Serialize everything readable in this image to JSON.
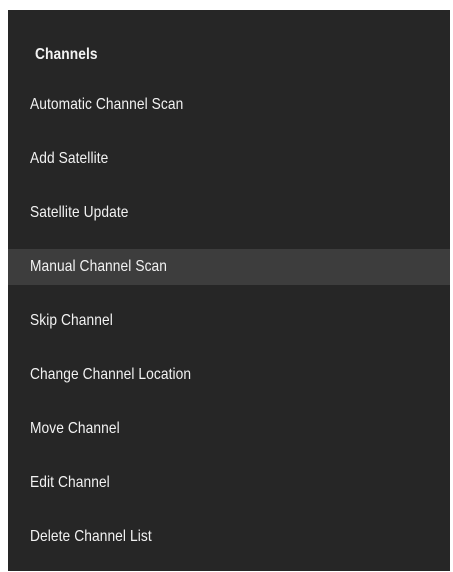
{
  "menu": {
    "title": "Channels",
    "items": [
      {
        "label": "Automatic Channel Scan",
        "selected": false
      },
      {
        "label": "Add Satellite",
        "selected": false
      },
      {
        "label": "Satellite Update",
        "selected": false
      },
      {
        "label": "Manual Channel Scan",
        "selected": true
      },
      {
        "label": "Skip Channel",
        "selected": false
      },
      {
        "label": "Change Channel Location",
        "selected": false
      },
      {
        "label": "Move Channel",
        "selected": false
      },
      {
        "label": "Edit Channel",
        "selected": false
      },
      {
        "label": "Delete Channel List",
        "selected": false
      }
    ]
  },
  "colors": {
    "panel_background": "#262626",
    "selected_background": "#3d3d3d",
    "text": "#f2f2f2"
  }
}
